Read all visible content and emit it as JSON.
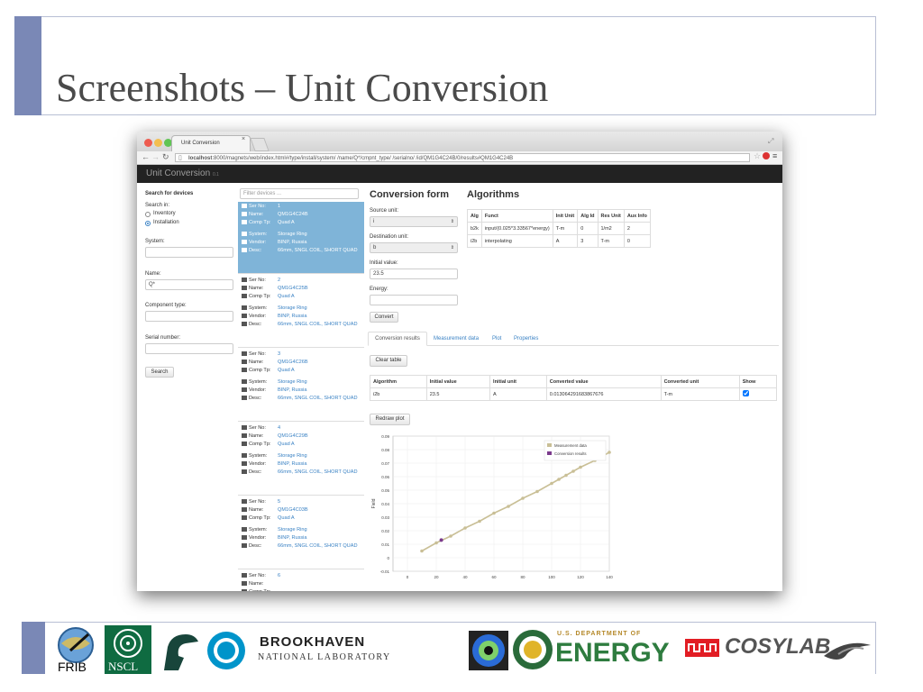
{
  "slide": {
    "title": "Screenshots – Unit Conversion"
  },
  "browser": {
    "tab_title": "Unit Conversion",
    "url_host": "localhost",
    "url_rest": ":8000/magnets/web/index.html#/type/install/system/ /name/Q*/cmpnt_type/ /serialno/ /id/QM1G4C24B/0/results#QM1G4C24B"
  },
  "app": {
    "brand": "Unit Conversion",
    "version": "0.1"
  },
  "search": {
    "heading": "Search for devices",
    "search_in_label": "Search in:",
    "options": [
      "Inventory",
      "Installation"
    ],
    "selected": "Installation",
    "system_label": "System:",
    "system_value": "",
    "name_label": "Name:",
    "name_value": "Q*",
    "component_label": "Component type:",
    "component_value": "",
    "serial_label": "Serial number:",
    "serial_value": "",
    "search_button": "Search"
  },
  "devices": {
    "filter_placeholder": "Filter devices ...",
    "keys": {
      "ser": "Ser No:",
      "name": "Name:",
      "comp": "Comp Tp:",
      "system": "System:",
      "vendor": "Vendor:",
      "desc": "Desc:"
    },
    "items": [
      {
        "ser": "1",
        "name": "QM1G4C24B",
        "comp": "Quad A",
        "system": "Storage Ring",
        "vendor": "BINP, Russia",
        "desc": "66mm, SNGL COIL, SHORT QUAD"
      },
      {
        "ser": "2",
        "name": "QM1G4C25B",
        "comp": "Quad A",
        "system": "Storage Ring",
        "vendor": "BINP, Russia",
        "desc": "66mm, SNGL COIL, SHORT QUAD"
      },
      {
        "ser": "3",
        "name": "QM1G4C26B",
        "comp": "Quad A",
        "system": "Storage Ring",
        "vendor": "BINP, Russia",
        "desc": "66mm, SNGL COIL, SHORT QUAD"
      },
      {
        "ser": "4",
        "name": "QM1G4C29B",
        "comp": "Quad A",
        "system": "Storage Ring",
        "vendor": "BINP, Russia",
        "desc": "66mm, SNGL COIL, SHORT QUAD"
      },
      {
        "ser": "5",
        "name": "QM1G4C03B",
        "comp": "Quad A",
        "system": "Storage Ring",
        "vendor": "BINP, Russia",
        "desc": "66mm, SNGL COIL, SHORT QUAD"
      },
      {
        "ser": "6",
        "name": "",
        "comp": "",
        "system": "",
        "vendor": "",
        "desc": ""
      }
    ]
  },
  "form": {
    "title": "Conversion form",
    "source_label": "Source unit:",
    "source_value": "i",
    "dest_label": "Destination unit:",
    "dest_value": "b",
    "initial_label": "Initial value:",
    "initial_value": "23.5",
    "energy_label": "Energy:",
    "energy_value": "",
    "convert_button": "Convert"
  },
  "algorithms": {
    "title": "Algorithms",
    "columns": [
      "Alg",
      "Funct",
      "Init Unit",
      "Alg Id",
      "Res Unit",
      "Aux Info"
    ],
    "rows": [
      [
        "b2k",
        "input/(0.025*3.33567*energy)",
        "T-m",
        "0",
        "1/m2",
        "2"
      ],
      [
        "i2b",
        "interpolating",
        "A",
        "3",
        "T-m",
        "0"
      ]
    ]
  },
  "results": {
    "tabs": [
      "Conversion results",
      "Measurement data",
      "Plot",
      "Properties"
    ],
    "active_tab": "Conversion results",
    "clear_button": "Clear table",
    "columns": [
      "Algorithm",
      "Initial value",
      "Initial unit",
      "Converted value",
      "Converted unit",
      "Show"
    ],
    "rows": [
      [
        "i2b",
        "23.5",
        "A",
        "0.013064291683867676",
        "T-m",
        true
      ]
    ],
    "redraw_button": "Redraw plot"
  },
  "chart_data": {
    "type": "scatter",
    "ylabel": "Field",
    "xlabel": "",
    "xlim": [
      -10,
      140
    ],
    "ylim": [
      -0.01,
      0.09
    ],
    "xticks": [
      0,
      20,
      40,
      60,
      80,
      100,
      120,
      140
    ],
    "yticks": [
      -0.01,
      0.0,
      0.01,
      0.02,
      0.03,
      0.04,
      0.05,
      0.06,
      0.07,
      0.08,
      0.09
    ],
    "legend_position": "top-right",
    "series": [
      {
        "name": "Measurement data",
        "color": "#c9bf96",
        "x": [
          10,
          20,
          30,
          40,
          50,
          60,
          70,
          80,
          90,
          100,
          105,
          110,
          115,
          120,
          130,
          140
        ],
        "y": [
          0.005,
          0.011,
          0.016,
          0.022,
          0.027,
          0.033,
          0.038,
          0.044,
          0.049,
          0.055,
          0.058,
          0.061,
          0.064,
          0.067,
          0.072,
          0.078
        ]
      },
      {
        "name": "Conversion results",
        "color": "#7b3a8c",
        "x": [
          23.5
        ],
        "y": [
          0.013064291683867676
        ]
      }
    ]
  },
  "footer": {
    "logos": [
      "FRIB",
      "NSCL",
      "MSU Spartan",
      "ESS",
      "BROOKHAVEN",
      "NATIONAL LABORATORY",
      "U.S. DEPARTMENT OF",
      "ENERGY",
      "COSYLAB"
    ]
  },
  "colors": {
    "accent": "#7a88b6",
    "selected": "#7fb4d8",
    "link": "#3a82c4",
    "navbar": "#222222"
  }
}
